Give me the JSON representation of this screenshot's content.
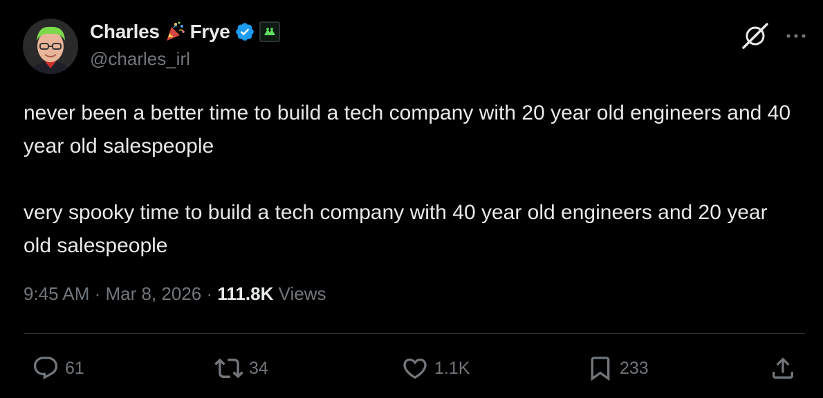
{
  "author": {
    "first_name": "Charles",
    "last_name": "Frye",
    "handle": "@charles_irl"
  },
  "tweet": {
    "paragraphs": [
      "never been a better time to build a tech company with 20 year old engineers and 40 year old salespeople",
      "very spooky time to build a tech company with 40 year old engineers and 20 year old salespeople"
    ]
  },
  "meta": {
    "time": "9:45 AM",
    "separator": " · ",
    "date": "Mar 8, 2026",
    "views_count": "111.8K",
    "views_label": " Views"
  },
  "actions": {
    "replies": "61",
    "reposts": "34",
    "likes": "1.1K",
    "bookmarks": "233"
  },
  "colors": {
    "background": "#000000",
    "text": "#e7e9ea",
    "muted": "#71767b",
    "verified": "#1d9bf0",
    "divider": "#2f3336"
  },
  "icons": {
    "verified": "verified-badge-icon",
    "affiliate": "affiliate-badge-icon",
    "grok": "grok-icon",
    "more": "more-icon",
    "reply": "reply-icon",
    "repost": "repost-icon",
    "like": "like-icon",
    "bookmark": "bookmark-icon",
    "share": "share-icon"
  }
}
